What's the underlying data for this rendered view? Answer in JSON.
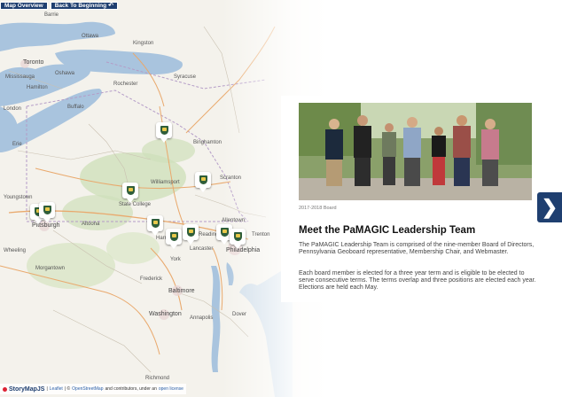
{
  "toolbar": {
    "map_overview": "Map Overview",
    "back_to_beginning": "Back To Beginning",
    "back_icon": "return-arrow-icon"
  },
  "map": {
    "cities": [
      {
        "name": "Barrie",
        "big": false
      },
      {
        "name": "Ottawa",
        "big": false
      },
      {
        "name": "Kingston",
        "big": false
      },
      {
        "name": "Toronto",
        "big": true
      },
      {
        "name": "Mississauga",
        "big": false
      },
      {
        "name": "Hamilton",
        "big": false
      },
      {
        "name": "Oshawa",
        "big": false
      },
      {
        "name": "Rochester",
        "big": false
      },
      {
        "name": "Syracuse",
        "big": false
      },
      {
        "name": "Buffalo",
        "big": false
      },
      {
        "name": "London",
        "big": false
      },
      {
        "name": "Binghamton",
        "big": false
      },
      {
        "name": "Erie",
        "big": false
      },
      {
        "name": "Scranton",
        "big": false
      },
      {
        "name": "Williamsport",
        "big": false
      },
      {
        "name": "Youngstown",
        "big": false
      },
      {
        "name": "Pittsburgh",
        "big": true
      },
      {
        "name": "Altoona",
        "big": false
      },
      {
        "name": "State College",
        "big": false
      },
      {
        "name": "Harrisburg",
        "big": false
      },
      {
        "name": "Allentown",
        "big": false
      },
      {
        "name": "Reading",
        "big": false
      },
      {
        "name": "Lancaster",
        "big": false
      },
      {
        "name": "York",
        "big": false
      },
      {
        "name": "Philadelphia",
        "big": true
      },
      {
        "name": "Trenton",
        "big": false
      },
      {
        "name": "Frederick",
        "big": false
      },
      {
        "name": "Baltimore",
        "big": true
      },
      {
        "name": "Washington",
        "big": true
      },
      {
        "name": "Annapolis",
        "big": false
      },
      {
        "name": "Dover",
        "big": false
      },
      {
        "name": "Morgantown",
        "big": false
      },
      {
        "name": "Richmond",
        "big": false
      },
      {
        "name": "Wheeling",
        "big": false
      }
    ],
    "marker_icon": "pamagic-shield-icon",
    "marker_count": 10
  },
  "panel": {
    "photo_alt": "Group photo of board members",
    "photo_caption": "2017-2018 Board",
    "heading": "Meet the PaMAGIC Leadership Team",
    "paragraph1": "The PaMAGIC Leadership Team is comprised of the nine-member Board of Directors, Pennsylvania Geoboard representative, Membership Chair, and Webmaster.",
    "paragraph2": "Each board member is elected for a three year term and is eligible to be elected to serve consecutive terms. The terms overlap and three positions are elected each year. Elections are held each May."
  },
  "navigation": {
    "next_icon": "chevron-right-icon",
    "next_symbol": "❯"
  },
  "footer": {
    "brand": "StoryMapJS",
    "sep1": " | ",
    "leaflet": "Leaflet",
    "sep2": " | © ",
    "osm": "OpenStreetMap",
    "contrib": " and contributors, under an ",
    "license": "open license"
  },
  "colors": {
    "nav_blue": "#1f3f70",
    "lake_blue": "#a9c4de",
    "marker_green": "#2f5e3a"
  }
}
